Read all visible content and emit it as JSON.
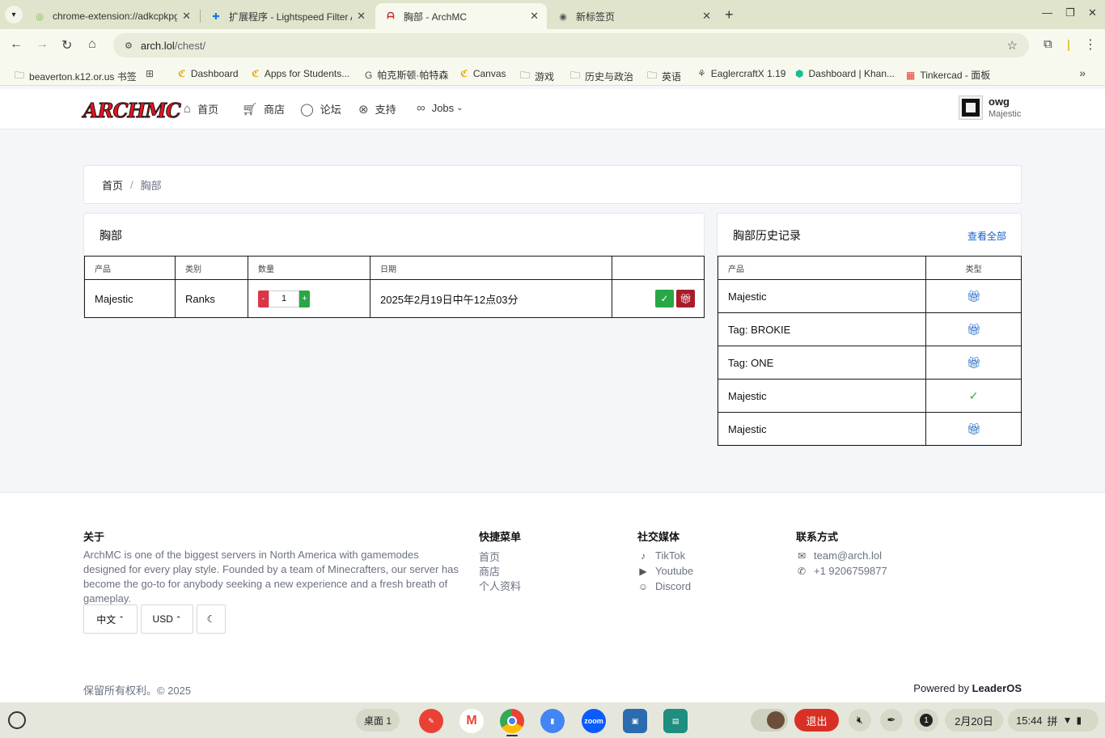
{
  "browser": {
    "tabs": [
      {
        "title": "chrome-extension://adkcpkpg",
        "favicon": "chrome-extension-icon"
      },
      {
        "title": "扩展程序 - Lightspeed Filter A",
        "favicon": "puzzle-icon"
      },
      {
        "title": "胸部 - ArchMC",
        "favicon": "archmc-icon"
      },
      {
        "title": "新标签页",
        "favicon": "chrome-icon"
      }
    ],
    "url_host": "arch.lol",
    "url_path": "/chest/",
    "bookmarks": [
      "beaverton.k12.or.us 书签",
      "Dashboard",
      "Apps for Students...",
      "帕克斯顿·帕特森",
      "Canvas",
      "游戏",
      "历史与政治",
      "英语",
      "EaglercraftX 1.19",
      "Dashboard | Khan...",
      "Tinkercad - 面板"
    ]
  },
  "site": {
    "logo": "ARCHMC",
    "nav": {
      "home": "首页",
      "store": "商店",
      "forum": "论坛",
      "support": "支持",
      "jobs": "Jobs"
    },
    "user": {
      "name": "owg",
      "rank": "Majestic"
    }
  },
  "breadcrumb": {
    "home": "首页",
    "separator": "/",
    "current": "胸部"
  },
  "chest": {
    "title": "胸部",
    "headers": {
      "product": "产品",
      "category": "类别",
      "quantity": "数量",
      "date": "日期"
    },
    "row": {
      "product": "Majestic",
      "category": "Ranks",
      "minus": "-",
      "quantity": "1",
      "plus": "+",
      "date": "2025年2月19日中午12点03分"
    }
  },
  "history": {
    "title": "胸部历史记录",
    "view_all": "查看全部",
    "headers": {
      "product": "产品",
      "type": "类型"
    },
    "rows": [
      {
        "product": "Majestic",
        "type_icon": "gift-icon"
      },
      {
        "product": "Tag: BROKIE",
        "type_icon": "gift-icon"
      },
      {
        "product": "Tag: ONE",
        "type_icon": "gift-icon"
      },
      {
        "product": "Majestic",
        "type_icon": "check-icon"
      },
      {
        "product": "Majestic",
        "type_icon": "gift-icon"
      }
    ]
  },
  "footer": {
    "about_title": "关于",
    "about_text": "ArchMC is one of the biggest servers in North America with gamemodes designed for every play style. Founded by a team of Minecrafters, our server has become the go-to for anybody seeking a new experience and a fresh breath of gameplay.",
    "quick_title": "快捷菜单",
    "quick_links": [
      "首页",
      "商店",
      "个人资料"
    ],
    "social_title": "社交媒体",
    "social_links": [
      "TikTok",
      "Youtube",
      "Discord"
    ],
    "contact_title": "联系方式",
    "email": "team@arch.lol",
    "phone": "+1 9206759877",
    "language": "中文",
    "currency": "USD",
    "copyright": "保留所有权利。© 2025",
    "powered_prefix": "Powered by",
    "powered_brand": "LeaderOS"
  },
  "shelf": {
    "desk": "桌面 1",
    "exit": "退出",
    "notification_count": "1",
    "date": "2月20日",
    "time": "15:44",
    "ime": "拼"
  },
  "colors": {
    "accent_blue": "#1662c4",
    "success_green": "#28a745",
    "danger_red": "#dc3545",
    "logo_red": "#e8121e"
  }
}
